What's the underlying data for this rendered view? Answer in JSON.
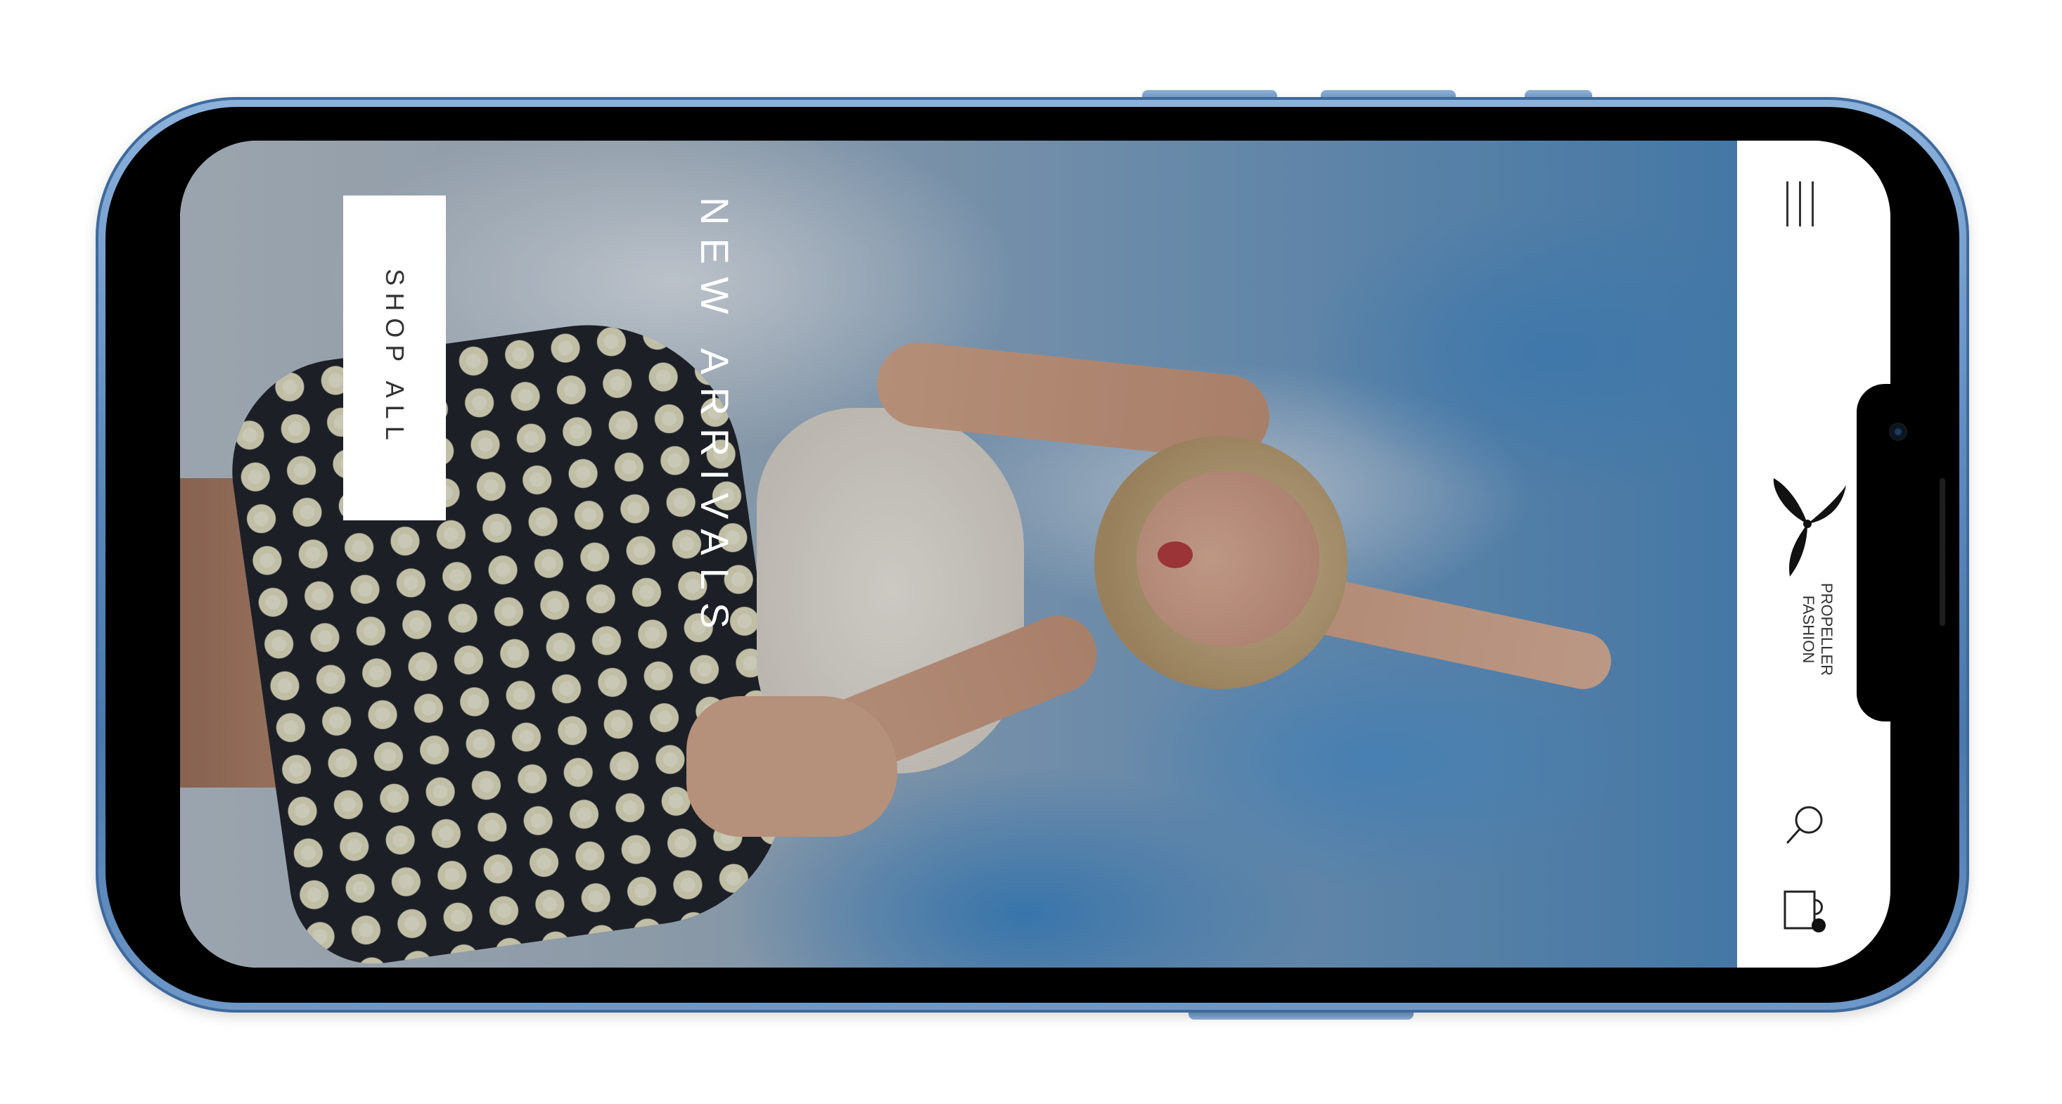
{
  "hero": {
    "headline": "NEW ARRIVALS",
    "cta_label": "SHOP ALL"
  },
  "header": {
    "brand_line1": "PROPELLER",
    "brand_line2": "FASHION",
    "icons": [
      "menu-icon",
      "propeller-logo-icon",
      "search-icon",
      "cart-icon"
    ]
  },
  "device": {
    "frame_color": "#5d89bd"
  }
}
